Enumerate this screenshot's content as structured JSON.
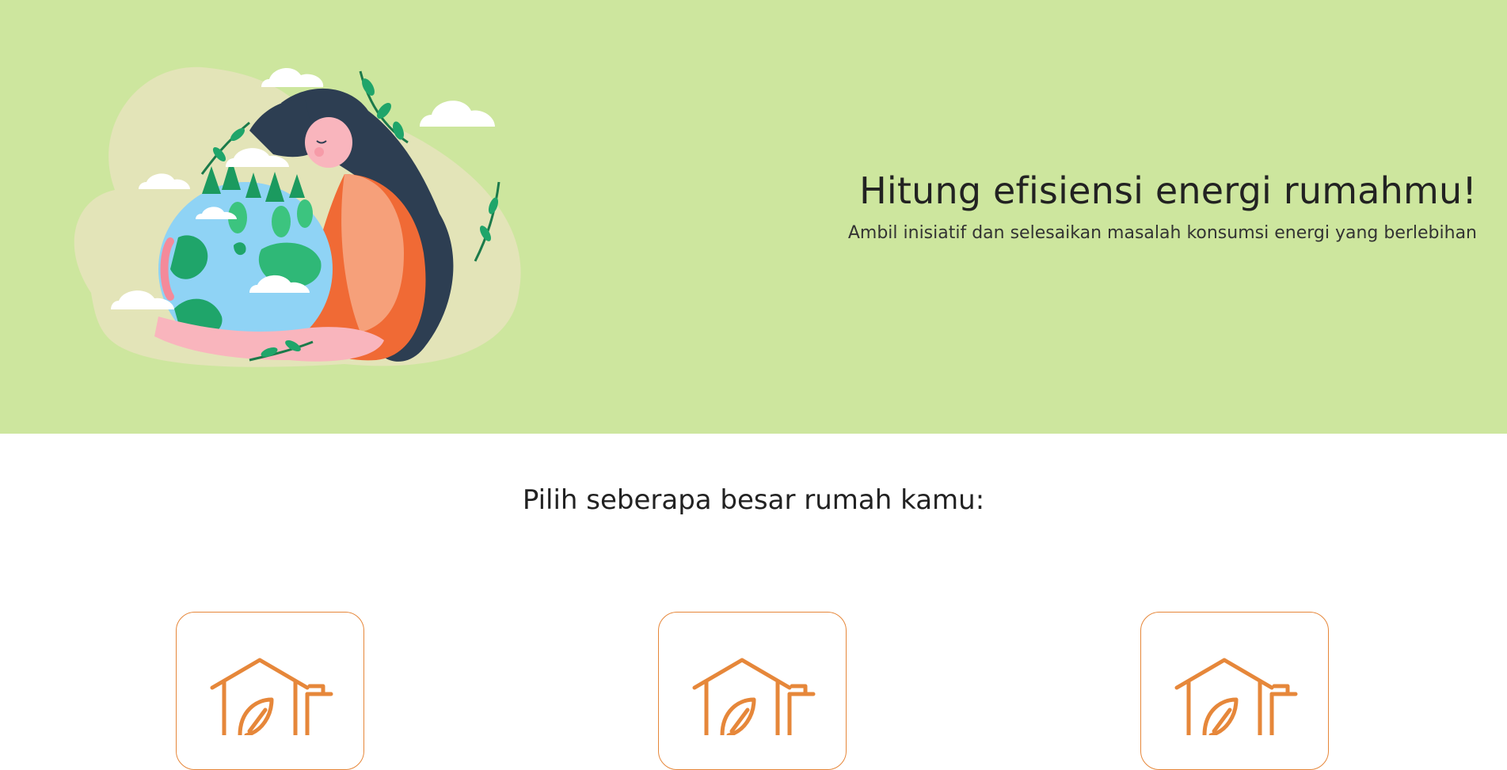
{
  "hero": {
    "title": "Hitung efisiensi energi rumahmu!",
    "subtitle": "Ambil inisiatif dan selesaikan masalah konsumsi energi yang berlebihan",
    "illustration": "woman-hugging-earth-illustration"
  },
  "section": {
    "title": "Pilih seberapa besar rumah kamu:"
  },
  "cards": [
    {
      "icon": "eco-house-icon"
    },
    {
      "icon": "eco-house-icon"
    },
    {
      "icon": "eco-house-icon"
    }
  ],
  "colors": {
    "hero_background": "#cde69e",
    "accent": "#e6873a",
    "text": "#222222"
  }
}
